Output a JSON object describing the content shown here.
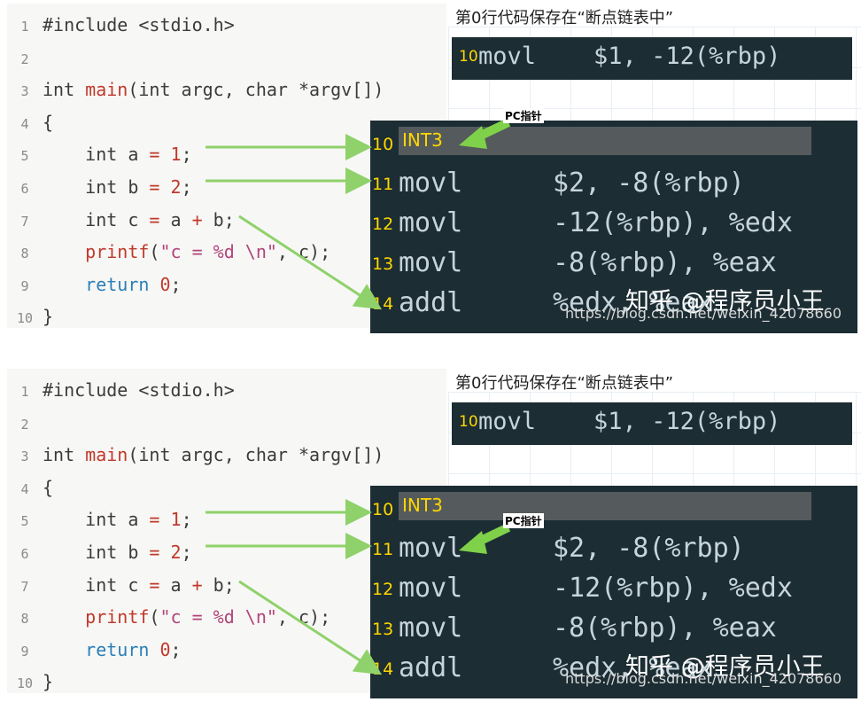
{
  "code": {
    "lines": [
      {
        "num": "1",
        "parts": [
          [
            "kw",
            "#include <stdio.h>"
          ]
        ]
      },
      {
        "num": "2",
        "parts": []
      },
      {
        "num": "3",
        "parts": [
          [
            "kw",
            "int "
          ],
          [
            "fn",
            "main"
          ],
          [
            "kw",
            "(int argc, char *argv[])"
          ]
        ]
      },
      {
        "num": "4",
        "parts": [
          [
            "kw",
            "{"
          ]
        ]
      },
      {
        "num": "5",
        "parts": [
          [
            "kw",
            "    int a "
          ],
          [
            "op",
            "="
          ],
          [
            "kw",
            " "
          ],
          [
            "num",
            "1"
          ],
          [
            "kw",
            ";"
          ]
        ]
      },
      {
        "num": "6",
        "parts": [
          [
            "kw",
            "    int b "
          ],
          [
            "op",
            "="
          ],
          [
            "kw",
            " "
          ],
          [
            "num",
            "2"
          ],
          [
            "kw",
            ";"
          ]
        ]
      },
      {
        "num": "7",
        "parts": [
          [
            "kw",
            "    int c "
          ],
          [
            "op",
            "="
          ],
          [
            "kw",
            " a "
          ],
          [
            "op",
            "+"
          ],
          [
            "kw",
            " b;"
          ]
        ]
      },
      {
        "num": "8",
        "parts": [
          [
            "kw",
            "    "
          ],
          [
            "fn",
            "printf"
          ],
          [
            "kw",
            "("
          ],
          [
            "str",
            "\"c = %d \\n\""
          ],
          [
            "kw",
            ", c);"
          ]
        ]
      },
      {
        "num": "9",
        "parts": [
          [
            "kw",
            "    "
          ],
          [
            "ret",
            "return"
          ],
          [
            "kw",
            " "
          ],
          [
            "num",
            "0"
          ],
          [
            "kw",
            ";"
          ]
        ]
      },
      {
        "num": "10",
        "parts": [
          [
            "kw",
            "}"
          ]
        ]
      }
    ]
  },
  "caption": "第0行代码保存在“断点链表中”",
  "breakpoint_list": {
    "num": "10",
    "instr": "movl    $1, -12(%rbp)"
  },
  "asm": [
    {
      "num": "10",
      "op": "INT3",
      "args": "",
      "int3": true
    },
    {
      "num": "11",
      "op": "movl",
      "args": "$2, -8(%rbp)"
    },
    {
      "num": "12",
      "op": "movl",
      "args": "-12(%rbp), %edx"
    },
    {
      "num": "13",
      "op": "movl",
      "args": "-8(%rbp), %eax"
    },
    {
      "num": "14",
      "op": "addl",
      "args": "%edx, %eax"
    }
  ],
  "pc_label": "PC指针",
  "watermark": {
    "cn": "知乎 @程序员小王",
    "url": "https://blog.csdn.net/weixin_42078660"
  },
  "panels": [
    {
      "id": "top",
      "pc_target": "10"
    },
    {
      "id": "bottom",
      "pc_target": "11"
    }
  ],
  "colors": {
    "code_bg": "#f7f7f5",
    "asm_bg": "#1c2d33",
    "arrow": "#8fd16a",
    "line_number": "#ffd700"
  }
}
